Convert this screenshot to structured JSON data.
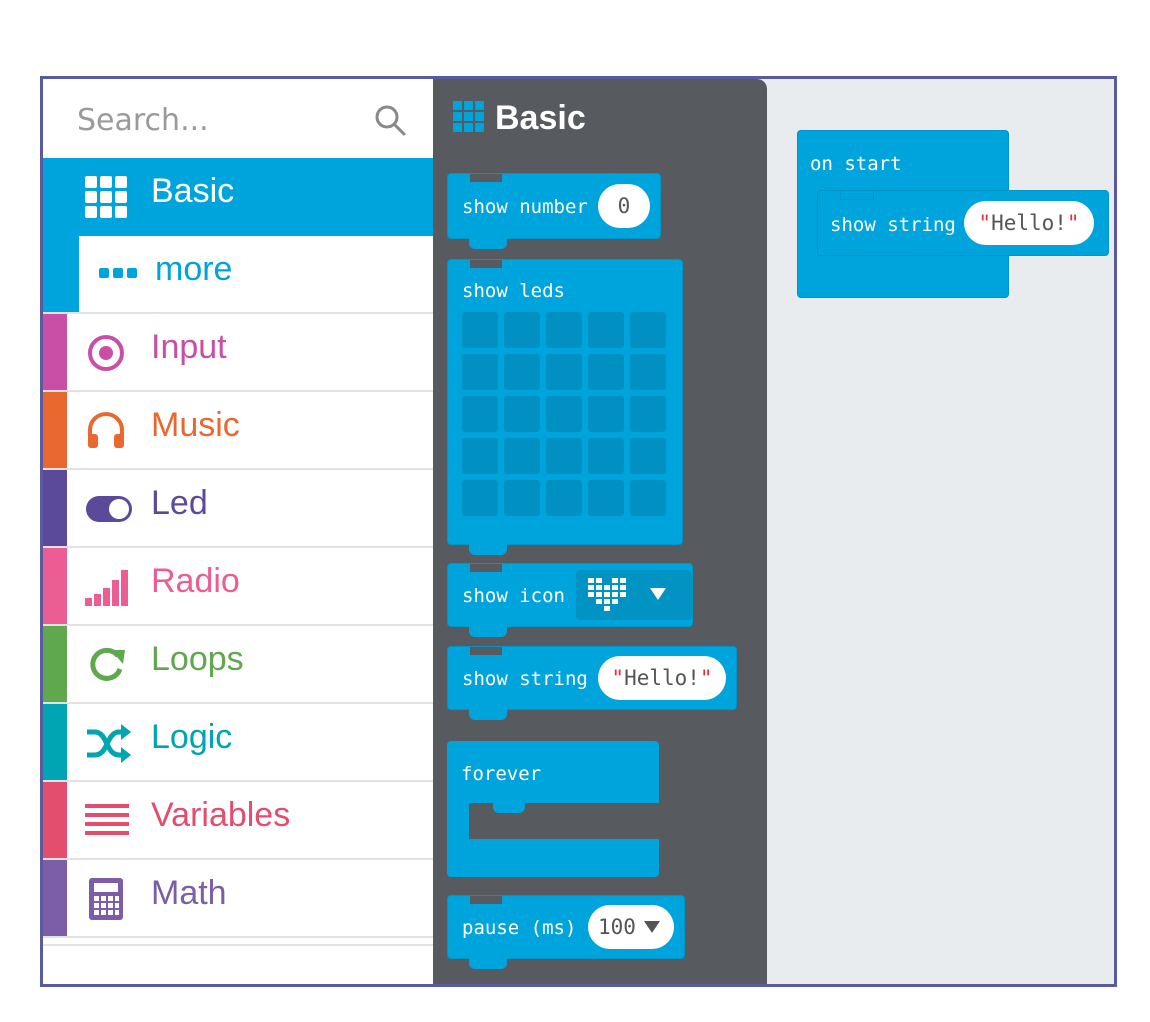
{
  "search": {
    "placeholder": "Search..."
  },
  "categories": [
    {
      "label": "Basic",
      "color": "#00a4dc",
      "icon": "grid-icon"
    },
    {
      "label": "more",
      "color": "#00a4dc",
      "icon": "dots-icon"
    },
    {
      "label": "Input",
      "color": "#c94fa6",
      "icon": "target-icon"
    },
    {
      "label": "Music",
      "color": "#e8682f",
      "icon": "headphones-icon"
    },
    {
      "label": "Led",
      "color": "#5b4a9a",
      "icon": "toggle-icon"
    },
    {
      "label": "Radio",
      "color": "#ec5d94",
      "icon": "signal-bars-icon"
    },
    {
      "label": "Loops",
      "color": "#5fa84e",
      "icon": "refresh-icon"
    },
    {
      "label": "Logic",
      "color": "#00a5b3",
      "icon": "shuffle-icon"
    },
    {
      "label": "Variables",
      "color": "#e34e6e",
      "icon": "list-lines-icon"
    },
    {
      "label": "Math",
      "color": "#7b5ea6",
      "icon": "calculator-icon"
    }
  ],
  "flyout": {
    "title": "Basic",
    "blocks": {
      "show_number": {
        "label": "show number",
        "value": "0"
      },
      "show_leds": {
        "label": "show leds"
      },
      "show_icon": {
        "label": "show icon"
      },
      "show_string": {
        "label": "show string",
        "q1": "\"",
        "value": "Hello!",
        "q2": "\""
      },
      "forever": {
        "label": "forever"
      },
      "pause": {
        "label": "pause (ms)",
        "value": "100"
      }
    }
  },
  "workspace": {
    "on_start": {
      "label": "on start"
    },
    "show_string": {
      "label": "show string",
      "q1": "\"",
      "value": "Hello!",
      "q2": "\""
    }
  }
}
